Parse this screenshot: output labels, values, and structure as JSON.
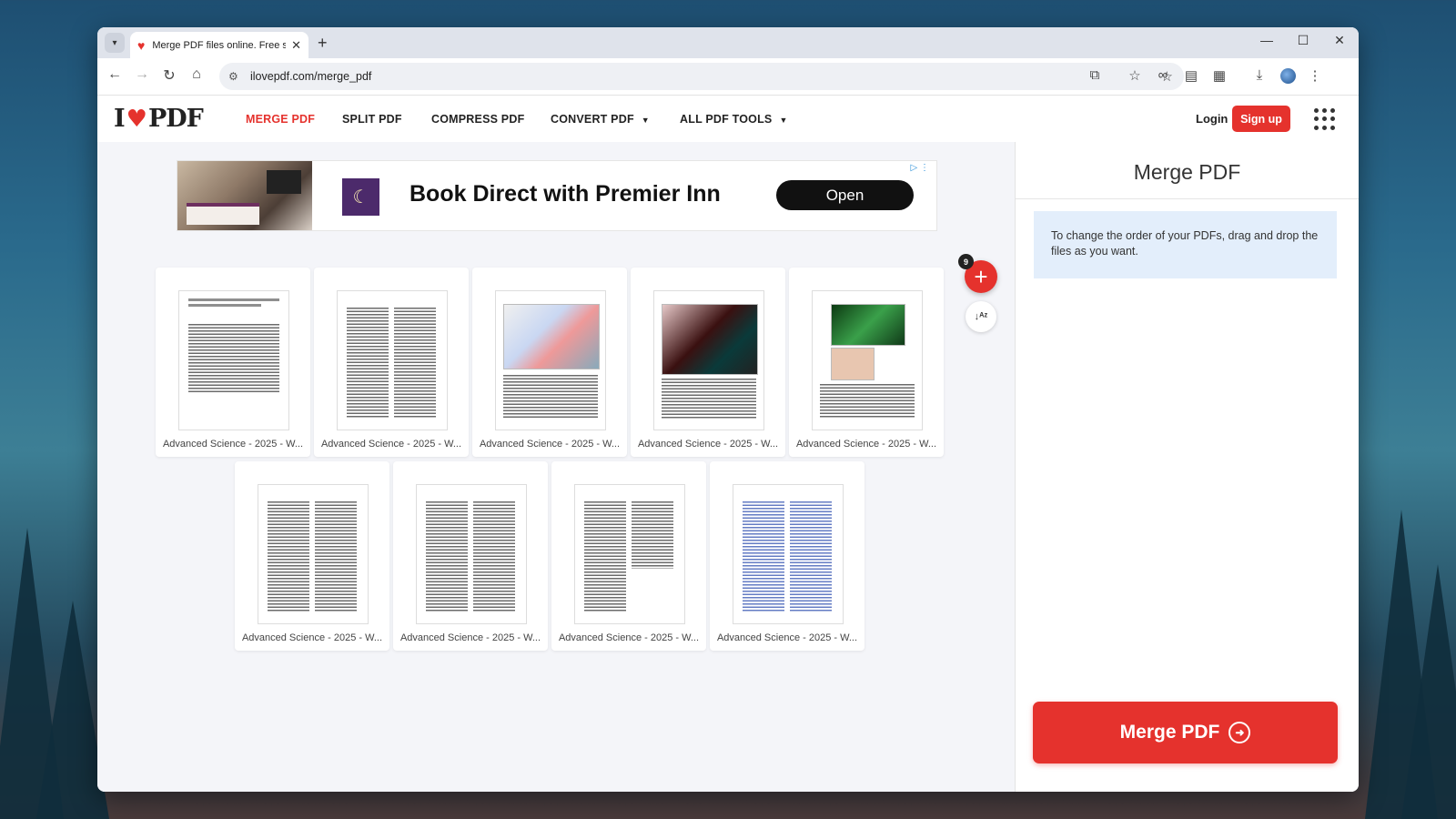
{
  "browser": {
    "tab_title": "Merge PDF files online. Free se",
    "url": "ilovepdf.com/merge_pdf"
  },
  "site": {
    "logo_left": "I",
    "logo_right": "PDF",
    "nav": [
      "MERGE PDF",
      "SPLIT PDF",
      "COMPRESS PDF",
      "CONVERT PDF",
      "ALL PDF TOOLS"
    ],
    "login": "Login",
    "signup": "Sign up"
  },
  "ad": {
    "headline": "Book Direct with Premier Inn",
    "button": "Open"
  },
  "files": {
    "count": "9",
    "names": [
      "Advanced Science - 2025 - W...",
      "Advanced Science - 2025 - W...",
      "Advanced Science - 2025 - W...",
      "Advanced Science - 2025 - W...",
      "Advanced Science - 2025 - W...",
      "Advanced Science - 2025 - W...",
      "Advanced Science - 2025 - W...",
      "Advanced Science - 2025 - W...",
      "Advanced Science - 2025 - W..."
    ]
  },
  "sidebar": {
    "title": "Merge PDF",
    "info": "To change the order of your PDFs, drag and drop the files as you want.",
    "merge_button": "Merge PDF"
  },
  "colors": {
    "brand_red": "#e5322d",
    "info_bg": "#e3eefb"
  }
}
